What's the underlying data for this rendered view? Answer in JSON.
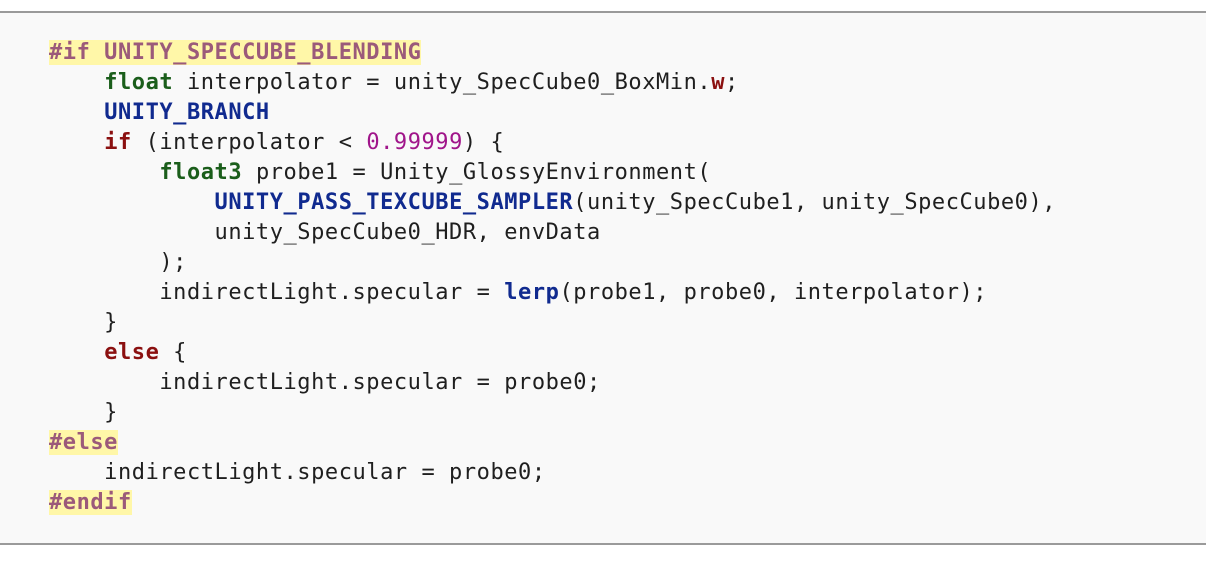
{
  "code_lines": [
    [
      {
        "t": "#if UNITY_SPECCUBE_BLENDING",
        "c": "preproc",
        "n": "preprocessor-if"
      }
    ],
    [
      {
        "t": "    ",
        "c": "plain",
        "n": "indent"
      },
      {
        "t": "float",
        "c": "kw-green",
        "n": "type-keyword"
      },
      {
        "t": " interpolator = unity_SpecCube0_BoxMin.",
        "c": "plain",
        "n": "code-text"
      },
      {
        "t": "w",
        "c": "member",
        "n": "member-access"
      },
      {
        "t": ";",
        "c": "plain",
        "n": "code-text"
      }
    ],
    [
      {
        "t": "    ",
        "c": "plain",
        "n": "indent"
      },
      {
        "t": "UNITY_BRANCH",
        "c": "macro",
        "n": "macro-name"
      }
    ],
    [
      {
        "t": "    ",
        "c": "plain",
        "n": "indent"
      },
      {
        "t": "if",
        "c": "kw-red",
        "n": "control-keyword"
      },
      {
        "t": " (interpolator < ",
        "c": "plain",
        "n": "code-text"
      },
      {
        "t": "0.99999",
        "c": "num",
        "n": "number-literal"
      },
      {
        "t": ") {",
        "c": "plain",
        "n": "code-text"
      }
    ],
    [
      {
        "t": "        ",
        "c": "plain",
        "n": "indent"
      },
      {
        "t": "float3",
        "c": "kw-green",
        "n": "type-keyword"
      },
      {
        "t": " probe1 = Unity_GlossyEnvironment(",
        "c": "plain",
        "n": "code-text"
      }
    ],
    [
      {
        "t": "            ",
        "c": "plain",
        "n": "indent"
      },
      {
        "t": "UNITY_PASS_TEXCUBE_SAMPLER",
        "c": "macro",
        "n": "macro-name"
      },
      {
        "t": "(unity_SpecCube1, unity_SpecCube0),",
        "c": "plain",
        "n": "code-text"
      }
    ],
    [
      {
        "t": "            unity_SpecCube0_HDR, envData",
        "c": "plain",
        "n": "code-text"
      }
    ],
    [
      {
        "t": "        );",
        "c": "plain",
        "n": "code-text"
      }
    ],
    [
      {
        "t": "        indirectLight.specular = ",
        "c": "plain",
        "n": "code-text"
      },
      {
        "t": "lerp",
        "c": "func",
        "n": "function-name"
      },
      {
        "t": "(probe1, probe0, interpolator);",
        "c": "plain",
        "n": "code-text"
      }
    ],
    [
      {
        "t": "    }",
        "c": "plain",
        "n": "code-text"
      }
    ],
    [
      {
        "t": "    ",
        "c": "plain",
        "n": "indent"
      },
      {
        "t": "else",
        "c": "kw-red",
        "n": "control-keyword"
      },
      {
        "t": " {",
        "c": "plain",
        "n": "code-text"
      }
    ],
    [
      {
        "t": "        indirectLight.specular = probe0;",
        "c": "plain",
        "n": "code-text"
      }
    ],
    [
      {
        "t": "    }",
        "c": "plain",
        "n": "code-text"
      }
    ],
    [
      {
        "t": "#else",
        "c": "preproc",
        "n": "preprocessor-else"
      }
    ],
    [
      {
        "t": "    indirectLight.specular = probe0;",
        "c": "plain",
        "n": "code-text"
      }
    ],
    [
      {
        "t": "#endif",
        "c": "preproc",
        "n": "preprocessor-endif"
      }
    ]
  ],
  "colors": {
    "background": "#f9f9f9",
    "border": "#9a9a9a",
    "preproc_highlight": "#fff7a8",
    "preproc_text": "#9b5a7a",
    "type_keyword": "#1b5e1b",
    "control_keyword": "#8b1010",
    "macro": "#102a8f",
    "number": "#a0158a"
  }
}
